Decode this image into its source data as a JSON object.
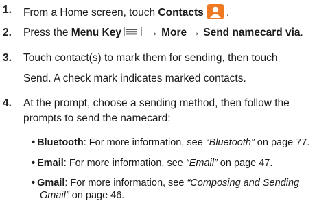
{
  "steps": [
    {
      "num": "1.",
      "pre": "From a Home screen, touch ",
      "bold1": "Contacts",
      "post": " ."
    },
    {
      "num": "2.",
      "pre": "Press the ",
      "bold1": "Menu Key",
      "arrow1": " → More → Send namecard via",
      "post": "."
    },
    {
      "num": "3.",
      "line1": "Touch contact(s) to mark them for sending, then touch",
      "line2": "Send. A check mark indicates marked contacts."
    },
    {
      "num": "4.",
      "line1": "At the prompt, choose a sending method, then follow the",
      "line2": "prompts to send the namecard:"
    }
  ],
  "bullets": [
    {
      "label": "Bluetooth",
      "text": ": For more information, see ",
      "ref": "“Bluetooth”",
      "page": " on page 77."
    },
    {
      "label": "Email",
      "text": ": For more information, see ",
      "ref": "“Email”",
      "page": " on page 47."
    },
    {
      "label": "Gmail",
      "text": ": For more information, see ",
      "ref": "“Composing and Sending",
      "ref2": "Gmail”",
      "page": " on page 46."
    }
  ],
  "icons": {
    "contacts": "contacts-icon",
    "menu": "menu-key-icon"
  },
  "colors": {
    "contacts_icon": "#f07a24"
  }
}
